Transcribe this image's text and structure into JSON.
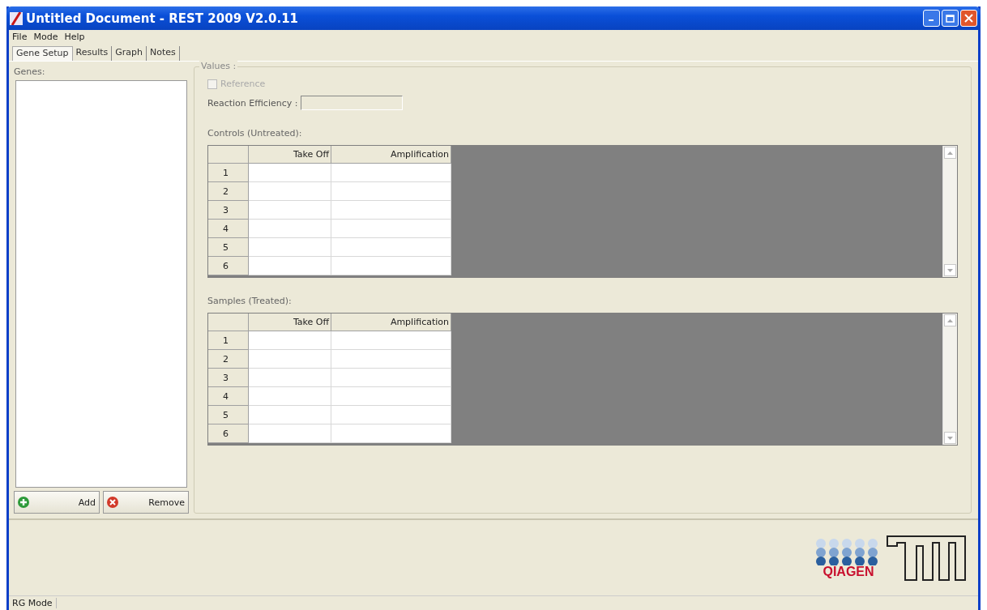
{
  "window": {
    "title": "Untitled Document - REST 2009 V2.0.11"
  },
  "menu": [
    "File",
    "Mode",
    "Help"
  ],
  "tabs": [
    {
      "label": "Gene Setup",
      "selected": true
    },
    {
      "label": "Results",
      "selected": false
    },
    {
      "label": "Graph",
      "selected": false
    },
    {
      "label": "Notes",
      "selected": false
    }
  ],
  "genes": {
    "label": "Genes:",
    "buttons": [
      {
        "label": "Add",
        "kind": "add"
      },
      {
        "label": "Remove",
        "kind": "remove"
      }
    ]
  },
  "values": {
    "title": "Values :",
    "reference": {
      "label": "Reference",
      "checked": false,
      "disabled": true
    },
    "efficiency": {
      "label": "Reaction Efficiency :",
      "disabled": true
    }
  },
  "grids": [
    {
      "title": "Controls (Untreated):",
      "columns": [
        "Take Off",
        "Amplification"
      ],
      "rows": [
        "1",
        "2",
        "3",
        "4",
        "5",
        "6"
      ]
    },
    {
      "title": "Samples (Treated):",
      "columns": [
        "Take Off",
        "Amplification"
      ],
      "rows": [
        "1",
        "2",
        "3",
        "4",
        "5",
        "6"
      ]
    }
  ],
  "logo": {
    "text": "QIAGEN"
  },
  "status_bar": "RG Mode"
}
